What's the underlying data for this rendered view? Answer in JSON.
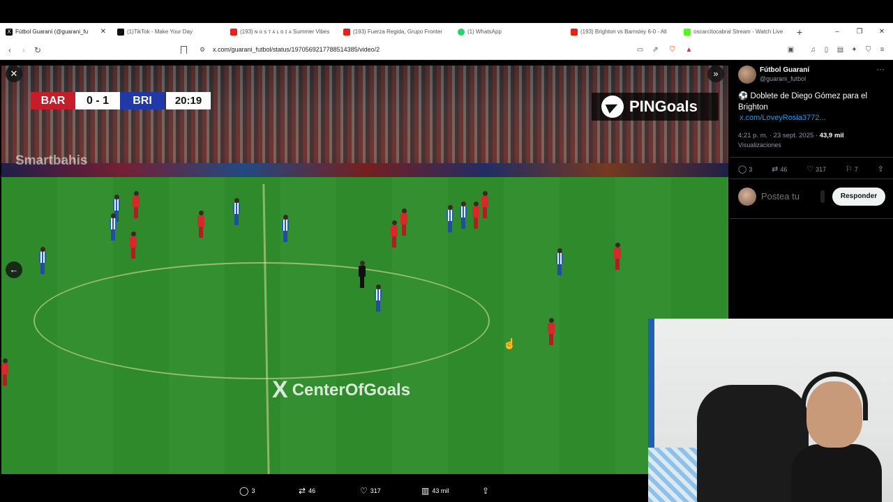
{
  "browser": {
    "tabs": [
      {
        "title": "Fútbol Guaraní (@guarani_fu",
        "icon": "x-icon",
        "color": "#000000",
        "active": true
      },
      {
        "title": "(1)TikTok - Make Your Day",
        "icon": "tiktok-icon",
        "color": "#111111"
      },
      {
        "title": "(193) ɴ ᴏ s ᴛ ᴀ ʟ ɢ ɪ ᴀ Summer Vibes",
        "icon": "youtube-icon",
        "color": "#e62117"
      },
      {
        "title": "(193) Fuerza Regida, Grupo Fronter",
        "icon": "youtube-icon",
        "color": "#e62117"
      },
      {
        "title": "(1) WhatsApp",
        "icon": "whatsapp-icon",
        "color": "#25d366"
      },
      {
        "title": "(193) Brighton vs Barnsley 6-0 - All",
        "icon": "youtube-icon",
        "color": "#e62117"
      },
      {
        "title": "oscarcitocabral Stream - Watch Live",
        "icon": "kick-icon",
        "color": "#53fc18"
      }
    ],
    "new_tab": "+",
    "window_controls": {
      "minimize": "–",
      "restore": "❐",
      "close": "✕"
    },
    "url": "x.com/guarani_futbol/status/1970569217788514385/video/2"
  },
  "video": {
    "scoreboard": {
      "home": "BAR",
      "score": "0 - 1",
      "away": "BRI",
      "clock": "20:19"
    },
    "watermark_top": "PINGoals",
    "watermark_center": "CenterOfGoals",
    "sponsor": "Smartbahis",
    "close": "✕",
    "expand": "»",
    "prev": "←"
  },
  "actions": {
    "replies": "3",
    "reposts": "46",
    "likes": "317",
    "views": "43 mil"
  },
  "post": {
    "author_name": "Fútbol Guaraní",
    "author_handle": "@guarani_futbol",
    "text": "⚽ Doblete de Diego Gómez para el Brighton",
    "link": "x.com/LoveyRosia3772...",
    "time": "4:21 p. m. · 23 sept. 2025 · ",
    "views": "43,9 mil",
    "views_label": "Visualizaciones",
    "stats": {
      "replies": "3",
      "reposts": "46",
      "likes": "317",
      "bookmarks": "7"
    },
    "reply_placeholder": "Postea tu",
    "reply_button": "Responder"
  }
}
